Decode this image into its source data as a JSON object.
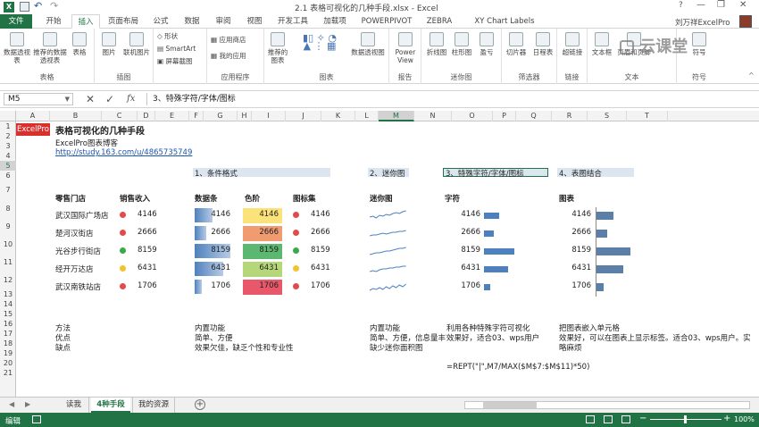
{
  "window": {
    "title": "2.1 表格可视化的几种手段.xlsx - Excel",
    "user": "刘万祥ExcelPro",
    "help": "?"
  },
  "tabs": [
    "文件",
    "开始",
    "插入",
    "页面布局",
    "公式",
    "数据",
    "审阅",
    "视图",
    "开发工具",
    "加载项",
    "POWERPIVOT",
    "ZEBRA",
    "XY Chart Labels"
  ],
  "active_tab": "插入",
  "ribbon": {
    "groups": [
      {
        "label": "表格",
        "buttons": [
          "数据透视表",
          "推荐的数据透视表",
          "表格"
        ]
      },
      {
        "label": "插图",
        "buttons": [
          "图片",
          "联机图片"
        ]
      },
      {
        "label": "",
        "buttons": [
          "形状",
          "SmartArt",
          "屏幕截图"
        ]
      },
      {
        "label": "应用程序",
        "buttons": [
          "应用商店",
          "我的应用"
        ]
      },
      {
        "label": "图表",
        "buttons": [
          "推荐的图表",
          "数据透视图"
        ]
      },
      {
        "label": "报告",
        "buttons": [
          "Power View"
        ]
      },
      {
        "label": "迷你图",
        "buttons": [
          "折线图",
          "柱形图",
          "盈亏"
        ]
      },
      {
        "label": "筛选器",
        "buttons": [
          "切片器",
          "日程表"
        ]
      },
      {
        "label": "链接",
        "buttons": [
          "超链接"
        ]
      },
      {
        "label": "文本",
        "buttons": [
          "文本框",
          "页眉和页脚"
        ]
      },
      {
        "label": "符号",
        "buttons": [
          "符号"
        ]
      }
    ],
    "watermark": "云课堂"
  },
  "formula_bar": {
    "name_box": "M5",
    "fx": "fx",
    "content": "3、特殊字符/字体/图标"
  },
  "columns": [
    "A",
    "B",
    "C",
    "D",
    "E",
    "F",
    "G",
    "H",
    "I",
    "J",
    "K",
    "L",
    "M",
    "N",
    "O",
    "P",
    "Q",
    "R",
    "S",
    "T"
  ],
  "rows": [
    "1",
    "2",
    "3",
    "4",
    "5",
    "6",
    "7",
    "8",
    "9",
    "10",
    "11",
    "12",
    "13",
    "14",
    "15",
    "16",
    "17",
    "18",
    "19",
    "20",
    "21"
  ],
  "sheet": {
    "badge": "ExcelPro",
    "title": "表格可视化的几种手段",
    "subtitle": "ExcelPro图表博客",
    "link": "http://study.163.com/u/4865735749",
    "sec1": "1、条件格式",
    "sec2": "2、迷你图",
    "sec3": "3、特殊字符/字体/图标",
    "sec4": "4、表图结合",
    "h_store": "零售门店",
    "h_sales": "销售收入",
    "h_databar": "数据条",
    "h_colorscale": "色阶",
    "h_iconset": "图标集",
    "h_sparkline": "迷你图",
    "h_char": "字符",
    "h_chart": "图表",
    "stores": [
      "武汉国际广场店",
      "楚河汉街店",
      "光谷步行街店",
      "经开万达店",
      "武汉南铁站店"
    ],
    "sales": [
      "4146",
      "2666",
      "8159",
      "6431",
      "1706"
    ],
    "sales_num": [
      4146,
      2666,
      8159,
      6431,
      1706
    ],
    "dot_colors": [
      "#e04c4c",
      "#e04c4c",
      "#3aa94a",
      "#f2c230",
      "#e04c4c"
    ],
    "scale_colors": [
      "#fbe27a",
      "#f19b70",
      "#5cb870",
      "#b5d77a",
      "#e8576a"
    ],
    "notes": {
      "l_method": "方法",
      "l_pro": "优点",
      "l_con": "缺点",
      "c1_method": "内置功能",
      "c1_pro": "简单、方便",
      "c1_con": "效果欠佳，缺乏个性和专业性",
      "c2_method": "内置功能",
      "c2_pro": "简单、方便，信息量丰富",
      "c2_con": "缺少迷你面积图",
      "c3_method": "利用各种特殊字符可视化",
      "c3_pro": "效果好，适合03、wps用户",
      "c3_formula": "=REPT(\"|\",M7/MAX($M$7:$M$11)*50)",
      "c4_method": "把图表嵌入单元格",
      "c4_pro": "效果好，可以在图表上显示标签。适合03、wps用户。实",
      "c4_con": "略麻烦"
    }
  },
  "sheet_tabs": [
    "读我",
    "4种手段",
    "我的资源"
  ],
  "active_sheet": "4种手段",
  "status": {
    "mode": "编辑",
    "zoom": "100%"
  }
}
